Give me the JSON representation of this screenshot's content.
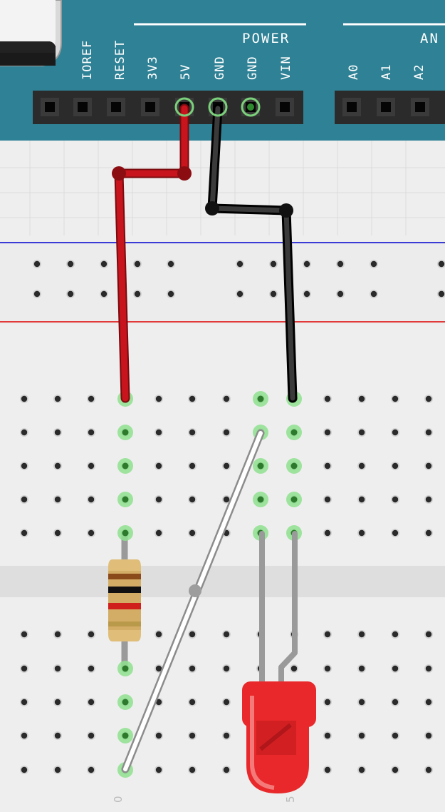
{
  "board": {
    "power_label": "POWER",
    "analog_label": "AN",
    "pins": [
      "IOREF",
      "RESET",
      "3V3",
      "5V",
      "GND",
      "GND",
      "VIN"
    ],
    "analog_pins": [
      "A0",
      "A1",
      "A2"
    ]
  },
  "breadboard": {
    "column_numbers": [
      "0",
      "5"
    ]
  },
  "colors": {
    "board_teal": "#2f8195",
    "wire_red": "#c8141c",
    "wire_black": "#1e1e1e",
    "wire_white": "#ffffff",
    "led_red": "#e8282a",
    "rail_blue": "#3b3bd6",
    "rail_red": "#e23a3a",
    "highlight_green": "#8ee08e"
  },
  "components": {
    "resistor": "resistor",
    "led": "red-led",
    "jumper_5v": "red-wire",
    "jumper_gnd": "black-wire",
    "jumper_bridge": "white-wire"
  }
}
